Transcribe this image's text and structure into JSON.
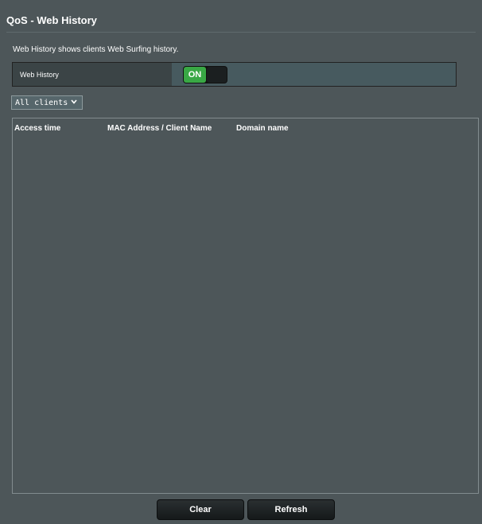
{
  "page": {
    "title": "QoS - Web History",
    "description": "Web History shows clients Web Surfing history."
  },
  "settings": {
    "web_history_label": "Web History",
    "toggle_on_text": "ON"
  },
  "filter": {
    "selected": "All clients"
  },
  "table": {
    "columns": [
      "Access time",
      "MAC Address / Client Name",
      "Domain name"
    ],
    "rows": []
  },
  "buttons": {
    "clear": "Clear",
    "refresh": "Refresh"
  }
}
